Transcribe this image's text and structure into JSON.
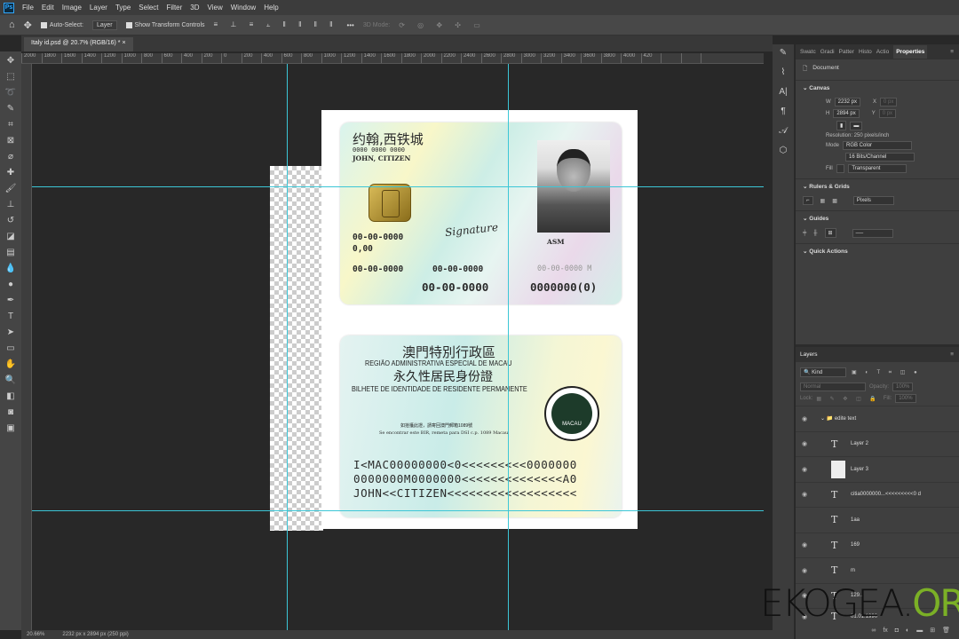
{
  "menu": {
    "logo": "Ps",
    "items": [
      "File",
      "Edit",
      "Image",
      "Layer",
      "Type",
      "Select",
      "Filter",
      "3D",
      "View",
      "Window",
      "Help"
    ]
  },
  "options": {
    "auto_select": "Auto-Select:",
    "auto_select_target": "Layer",
    "show_transform": "Show Transform Controls",
    "more": "•••",
    "mode_3d": "3D Mode:"
  },
  "document_tab": {
    "title": "Italy id.psd @ 20.7% (RGB/16) *",
    "close": "×"
  },
  "ruler": [
    "2000",
    "1800",
    "1600",
    "1400",
    "1200",
    "1000",
    "800",
    "600",
    "400",
    "200",
    "0",
    "200",
    "400",
    "600",
    "800",
    "1000",
    "1200",
    "1400",
    "1600",
    "1800",
    "2000",
    "2200",
    "2400",
    "2600",
    "2800",
    "3000",
    "3200",
    "3400",
    "3600",
    "3800",
    "4000",
    "420"
  ],
  "status": {
    "zoom": "20.66%",
    "size": "2232 px x 2894 px (250 ppi)"
  },
  "card_front": {
    "name_cn": "约翰,西铁城",
    "number": "0000 0000 0000",
    "name_en": "JOHN, CITIZEN",
    "signature": "Signature",
    "date1": "00-00-0000",
    "value": "0,00",
    "date2": "00-00-0000",
    "date3": "00-00-0000",
    "date4": "00-00-0000 M",
    "date5": "00-00-0000",
    "id": "0000000(0)",
    "photo_label": "ASM"
  },
  "card_back": {
    "region_cn": "澳門特別行政區",
    "region_pt": "REGIÃO ADMINISTRATIVA ESPECIAL DE MACAU",
    "title_cn": "永久性居民身份證",
    "title_pt": "BILHETE DE IDENTIDADE DE RESIDENTE PERMANENTE",
    "notice_cn": "如拾獲此證，請寄回澳門郵箱1089號",
    "notice_pt": "Se encontrar este BIR, remeta para DSI c.p. 1089 Macau",
    "seal": "MACAU",
    "mrz": [
      "I<MAC00000000<0<<<<<<<<<0000000",
      "0000000M0000000<<<<<<<<<<<<<<A0",
      "JOHN<<CITIZEN<<<<<<<<<<<<<<<<<<"
    ]
  },
  "properties": {
    "tabs": [
      "Swatc",
      "Gradi",
      "Patter",
      "Histo",
      "Actio",
      "Properties"
    ],
    "document": "Document",
    "canvas": "Canvas",
    "w_label": "W",
    "w": "2232 px",
    "h_label": "H",
    "h": "2894 px",
    "x_label": "X",
    "y_label": "Y",
    "x": "0 px",
    "y": "0 px",
    "resolution": "Resolution: 250 pixels/inch",
    "mode_label": "Mode",
    "mode": "RGB Color",
    "depth": "16 Bits/Channel",
    "fill_label": "Fill",
    "fill": "Transparent",
    "rulers": "Rulers & Grids",
    "units": "Pixels",
    "guides": "Guides",
    "quick_actions": "Quick Actions"
  },
  "layers": {
    "title": "Layers",
    "kind": "Kind",
    "blend": "Normal",
    "opacity_label": "Opacity:",
    "opacity": "100%",
    "lock_label": "Lock:",
    "fill_label": "Fill:",
    "fill": "100%",
    "group": "edite text",
    "items": [
      "Layer 2",
      "Layer 3",
      "citia0000000...<<<<<<<<<0 d",
      "1aa",
      "169",
      "m",
      "129...",
      "01.01.1990"
    ]
  },
  "watermark": {
    "a": "EKOGEA.",
    "b": "ORG"
  }
}
